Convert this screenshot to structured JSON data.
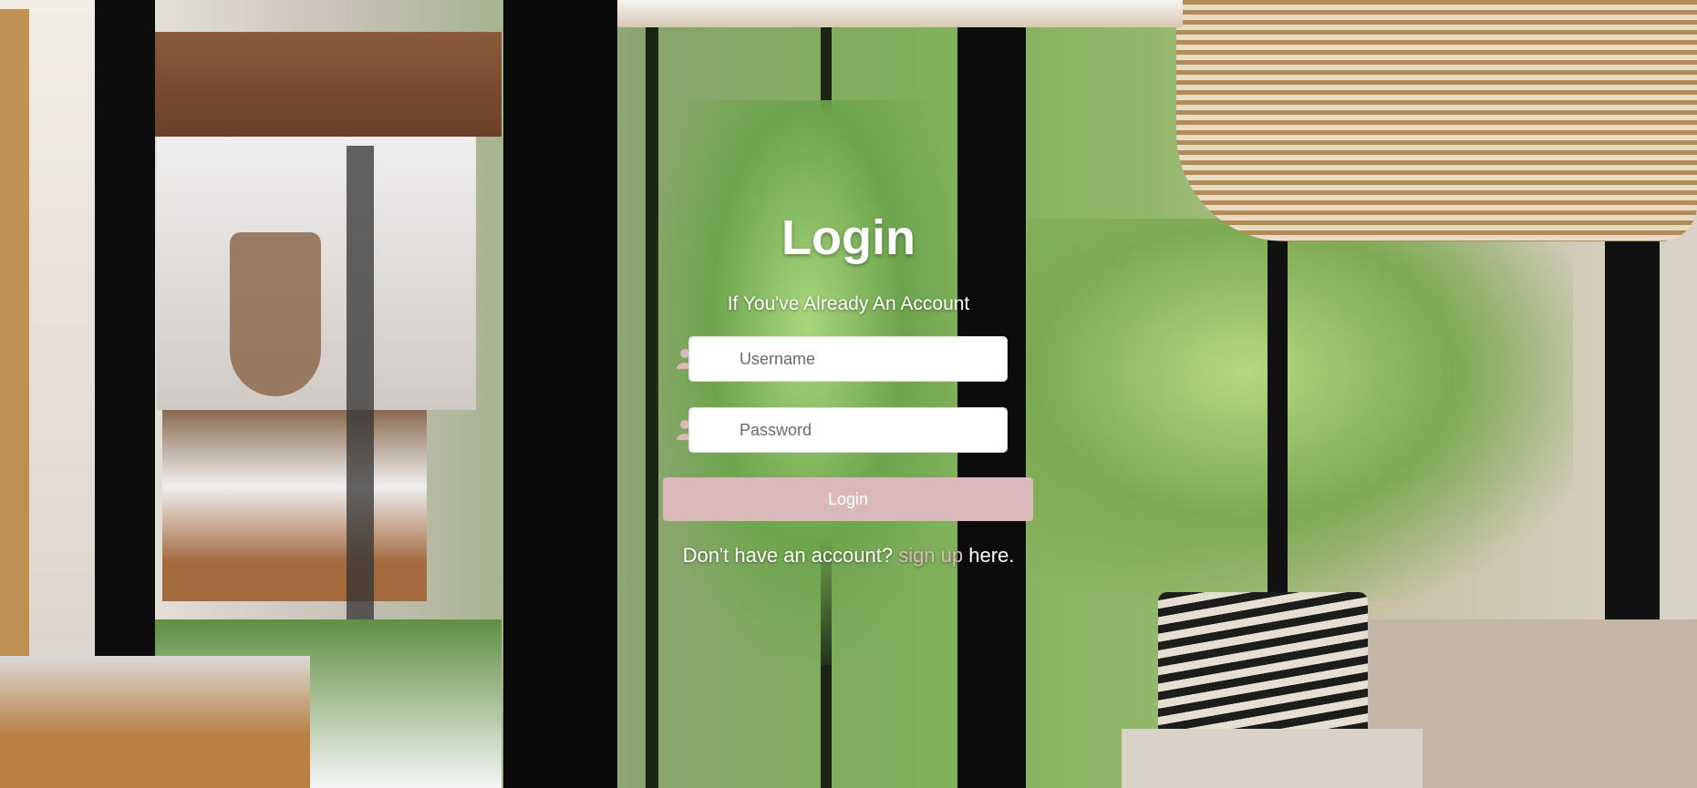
{
  "login": {
    "title": "Login",
    "subtitle": "If You've Already An Account",
    "username_placeholder": "Username",
    "password_placeholder": "Password",
    "button_label": "Login",
    "signup_prefix": "Don't have an account? ",
    "signup_link_text": "sign up",
    "signup_suffix": " here."
  },
  "colors": {
    "accent": "#dbb8b9",
    "text": "#ffffff",
    "input_background": "#ffffff"
  },
  "icons": {
    "username": "user-icon",
    "password": "user-icon"
  }
}
